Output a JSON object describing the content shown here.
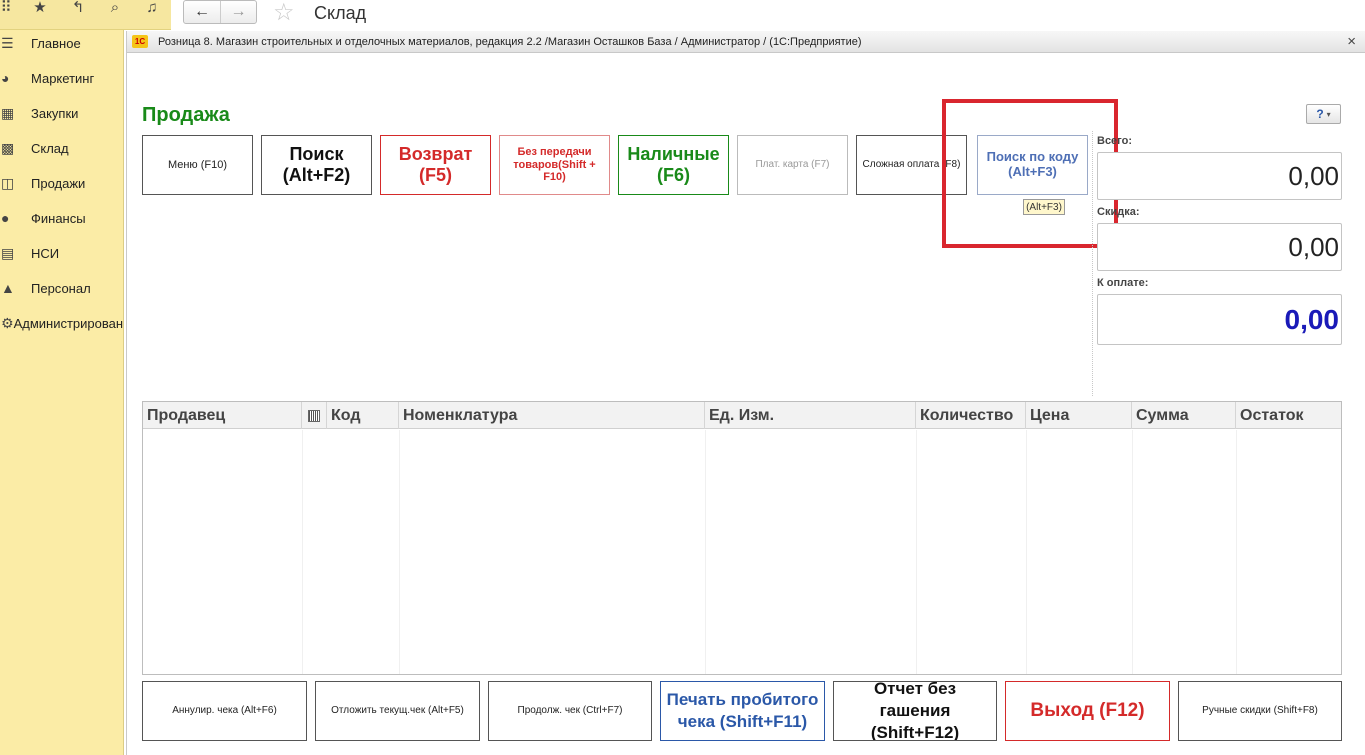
{
  "top_toolbar": {
    "icons": [
      "apps-grid-icon",
      "star-icon",
      "history-icon",
      "search-icon",
      "bell-icon"
    ],
    "back_glyph": "←",
    "forward_glyph": "→",
    "section_title": "Склад"
  },
  "sidebar": {
    "items": [
      {
        "label": "Главное",
        "icon": "hamburger-icon"
      },
      {
        "label": "Маркетинг",
        "icon": "pie-icon"
      },
      {
        "label": "Закупки",
        "icon": "cart-icon"
      },
      {
        "label": "Склад",
        "icon": "grid-icon"
      },
      {
        "label": "Продажи",
        "icon": "basket-icon"
      },
      {
        "label": "Финансы",
        "icon": "ruble-icon"
      },
      {
        "label": "НСИ",
        "icon": "docs-icon"
      },
      {
        "label": "Персонал",
        "icon": "person-icon"
      },
      {
        "label": "Администрирование",
        "icon": "gear-icon"
      }
    ]
  },
  "window": {
    "logo": "1С",
    "title": "Розница 8. Магазин строительных и отделочных материалов, редакция 2.2 /Магазин Осташков База / Администратор /  (1С:Предприятие)",
    "close_glyph": "×"
  },
  "page": {
    "title": "Продажа",
    "help_label": "?"
  },
  "top_buttons": {
    "menu": "Меню (F10)",
    "search": "Поиск\n(Alt+F2)",
    "return": "Возврат\n(F5)",
    "no_transfer": "Без передачи товаров(Shift + F10)",
    "cash": "Наличные\n(F6)",
    "card": "Плат. карта (F7)",
    "complex_pay": "Сложная оплата (F8)",
    "code_search": "Поиск по коду (Alt+F3)"
  },
  "tooltip": "(Alt+F3)",
  "totals": {
    "total_label": "Всего:",
    "total_value": "0,00",
    "discount_label": "Скидка:",
    "discount_value": "0,00",
    "to_pay_label": "К оплате:",
    "to_pay_value": "0,00"
  },
  "grid": {
    "columns": [
      "Продавец",
      "",
      "Код",
      "Номенклатура",
      "Ед. Изм.",
      "Количество",
      "Цена",
      "Сумма",
      "Остаток"
    ]
  },
  "bottom_buttons": {
    "cancel_check": "Аннулир. чека (Alt+F6)",
    "postpone_check": "Отложить текущ.чек (Alt+F5)",
    "continue_check": "Продолж. чек (Ctrl+F7)",
    "print_check": "Печать пробитого чека (Shift+F11)",
    "x_report": "Отчет без гашения (Shift+F12)",
    "exit": "Выход (F12)",
    "manual_discounts": "Ручные скидки (Shift+F8)"
  },
  "colors": {
    "sidebar_bg": "#fbeca6",
    "accent_green": "#198a19",
    "accent_red": "#d42a2a",
    "accent_blue": "#2b58a8",
    "pay_value": "#1a1ab8",
    "highlight": "#d9262e"
  }
}
